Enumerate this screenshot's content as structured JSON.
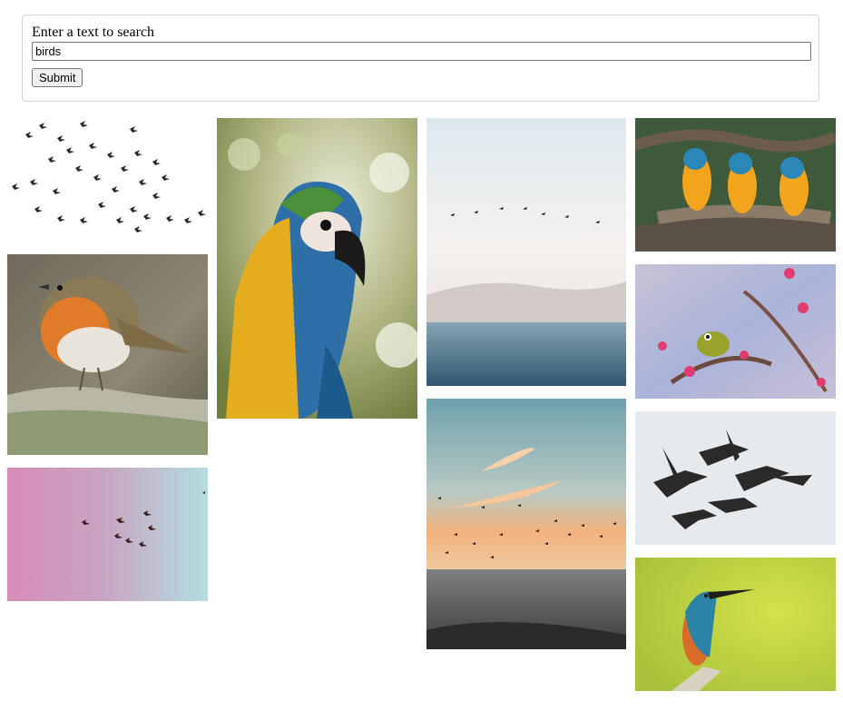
{
  "search": {
    "label": "Enter a text to search",
    "value": "birds",
    "submit_label": "Submit"
  },
  "gallery": {
    "images": [
      {
        "name": "flock-of-birds-white-sky-image"
      },
      {
        "name": "robin-on-mossy-branch-image"
      },
      {
        "name": "birds-over-pink-teal-sky-image"
      },
      {
        "name": "blue-yellow-macaw-closeup-image"
      },
      {
        "name": "birds-over-sea-horizon-image"
      },
      {
        "name": "birds-over-sunset-sea-image"
      },
      {
        "name": "three-macaws-on-branch-image"
      },
      {
        "name": "white-eye-on-blossom-branch-image"
      },
      {
        "name": "flying-geese-image"
      },
      {
        "name": "kingfisher-on-branch-image"
      }
    ]
  }
}
